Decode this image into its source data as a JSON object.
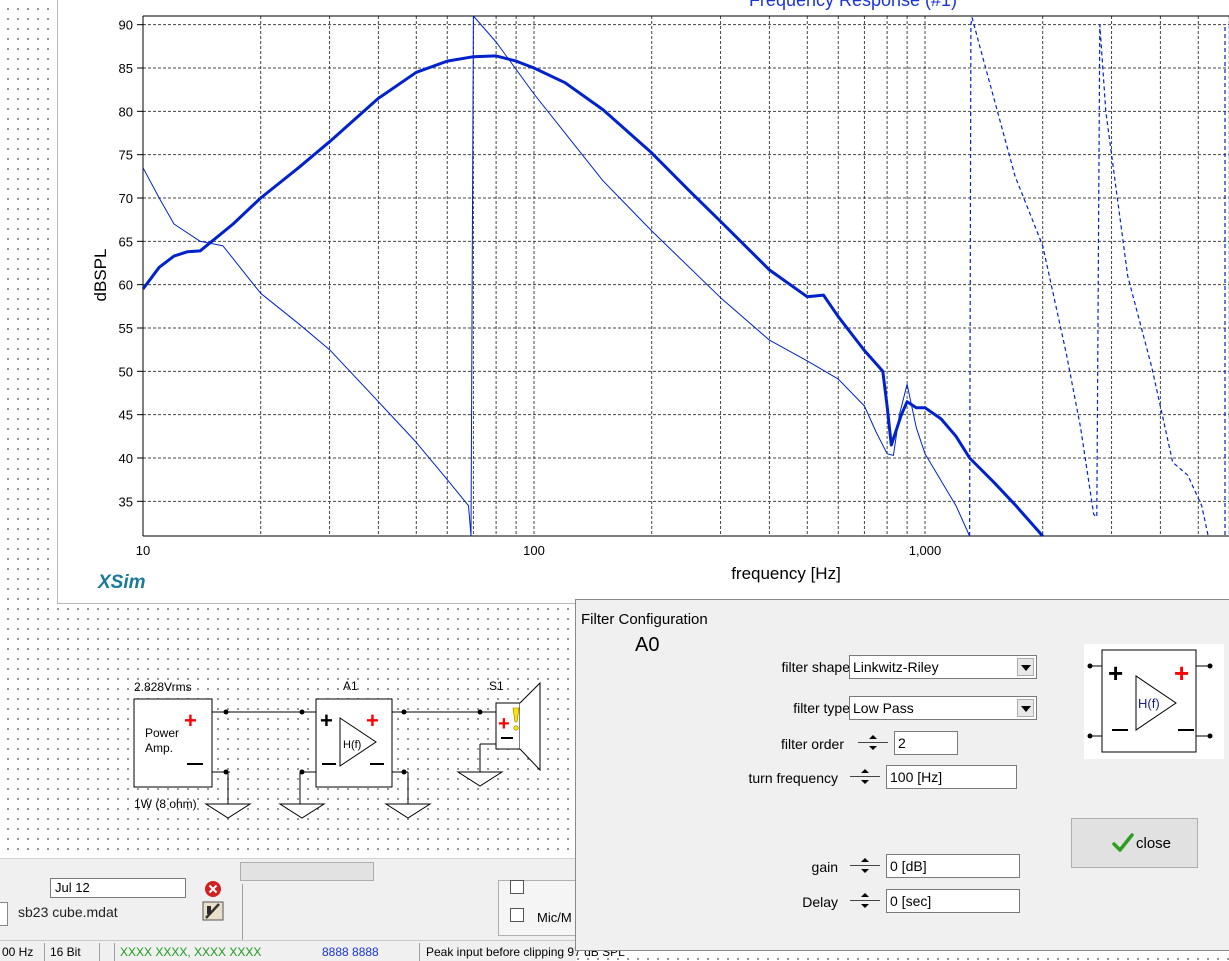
{
  "chart": {
    "title": "Frequency Response (#1)",
    "xlabel": "frequency [Hz]",
    "ylabel": "dBSPL",
    "brand": "XSim",
    "yticks": [
      "90",
      "85",
      "80",
      "75",
      "70",
      "65",
      "60",
      "55",
      "50",
      "45",
      "40",
      "35"
    ],
    "xticks": [
      "10",
      "100",
      "1,000"
    ]
  },
  "chart_data": {
    "type": "line",
    "title": "Frequency Response (#1)",
    "xlabel": "frequency [Hz]",
    "ylabel": "dBSPL",
    "xscale": "log",
    "xlim": [
      10,
      5500
    ],
    "ylim": [
      31,
      91
    ],
    "grid": true,
    "colors": {
      "lines": "#0022cc",
      "grid": "#444444"
    },
    "series": [
      {
        "style": "thick",
        "x": [
          10,
          11,
          12,
          13,
          14,
          15,
          17,
          20,
          25,
          30,
          40,
          50,
          60,
          70,
          80,
          90,
          100,
          120,
          150,
          200,
          250,
          300,
          400,
          500,
          550,
          600,
          700,
          780,
          800,
          820,
          870,
          900,
          950,
          1000,
          1100,
          1200,
          1300,
          1500,
          1700,
          2000
        ],
        "y": [
          59.5,
          62,
          63.3,
          63.8,
          63.9,
          65,
          67,
          70,
          73.5,
          76.5,
          81.5,
          84.5,
          85.8,
          86.3,
          86.4,
          85.8,
          85,
          83.3,
          80.2,
          75.2,
          70.8,
          67.3,
          61.7,
          58.6,
          58.8,
          56.3,
          52.4,
          50,
          46,
          41.5,
          45,
          46.5,
          45.8,
          45.8,
          44.5,
          42.5,
          40,
          37.2,
          34.6,
          31
        ]
      },
      {
        "style": "thin",
        "x": [
          10,
          11,
          12,
          14,
          16,
          20,
          25,
          30,
          40,
          50,
          60,
          68,
          69,
          70,
          80,
          100,
          150,
          200,
          300,
          400,
          500,
          600,
          700,
          750,
          800,
          830,
          860,
          900,
          950,
          1000,
          1200,
          1300
        ],
        "y": [
          73.5,
          70,
          67,
          65,
          64.5,
          59,
          55.5,
          52.5,
          46.5,
          41.8,
          37.5,
          34.5,
          31,
          91,
          88,
          82,
          72,
          66.2,
          58.5,
          53.6,
          51.2,
          49.1,
          46,
          43,
          40.5,
          40.3,
          45,
          48.5,
          43.5,
          40.5,
          34.5,
          31
        ]
      },
      {
        "style": "dashed",
        "x": [
          1300,
          1310,
          1320,
          1400,
          1500,
          1700,
          2000,
          2300,
          2500,
          2700,
          2750,
          2800,
          2900,
          3300,
          3800,
          4300,
          4700,
          5100,
          5300
        ],
        "y": [
          31,
          90,
          90.8,
          86.5,
          81.5,
          72.5,
          64.5,
          52,
          43.5,
          33.5,
          33.2,
          90,
          80,
          61,
          50.5,
          39.5,
          38,
          34.5,
          31
        ]
      }
    ]
  },
  "schematic": {
    "source_voltage": "2.828Vrms",
    "source_label_1": "Power",
    "source_label_2": "Amp.",
    "source_power": "1W (8 ohm)",
    "filter_ref": "A1",
    "filter_symbol": "H(f)",
    "speaker_ref": "S1"
  },
  "bottom": {
    "date_value": "Jul 12",
    "file_name": "sb23 cube.mdat",
    "mic_label": "Mic/M"
  },
  "status": {
    "rate": "00 Hz",
    "bits": "16 Bit",
    "coords": "XXXX XXXX, XXXX XXXX",
    "value": "8888 8888",
    "peak": "Peak input before clipping 97 dB SPL"
  },
  "dialog": {
    "title": "Filter Configuration",
    "name": "A0",
    "shape_label": "filter shape",
    "shape_value": "Linkwitz-Riley",
    "type_label": "filter type",
    "type_value": "Low Pass",
    "order_label": "filter order",
    "order_value": "2",
    "turn_label": "turn frequency",
    "turn_value": "100 [Hz]",
    "gain_label": "gain",
    "gain_value": "0 [dB]",
    "delay_label": "Delay",
    "delay_value": "0 [sec]",
    "close_label": "close",
    "symbol_text": "H(f)"
  }
}
